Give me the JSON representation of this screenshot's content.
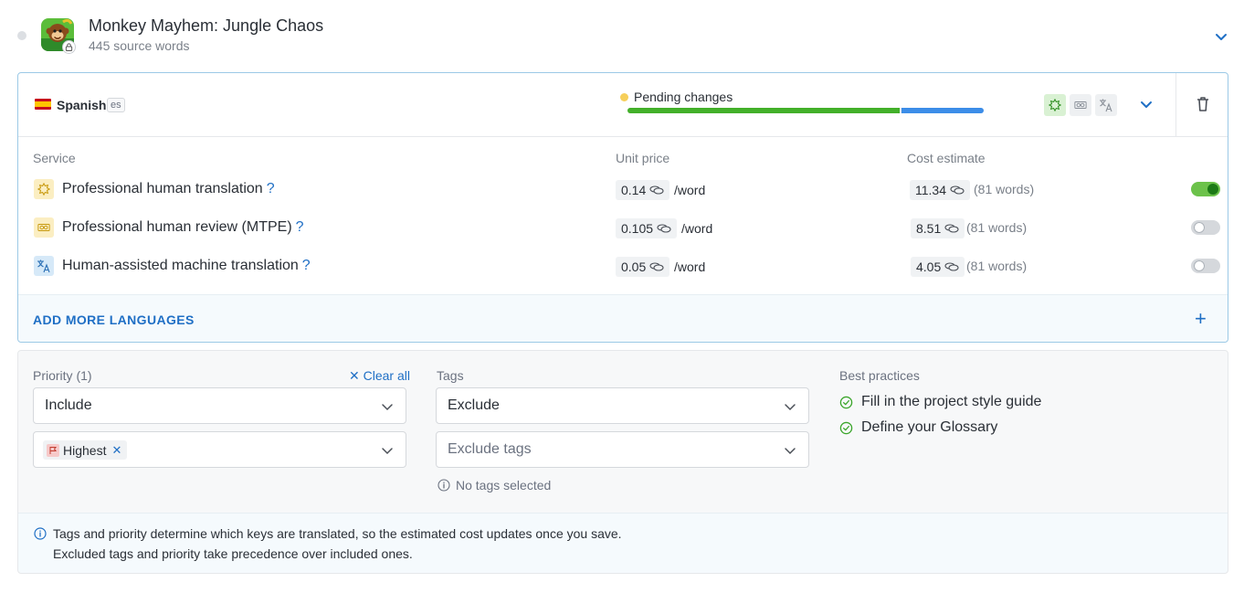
{
  "project": {
    "title": "Monkey Mayhem: Jungle Chaos",
    "subtitle": "445 source words"
  },
  "language": {
    "name": "Spanish",
    "code": "es",
    "status": "Pending changes",
    "progress": {
      "completed_fraction": 0.764,
      "in_progress_fraction": 0.23
    }
  },
  "services_table": {
    "headers": {
      "service": "Service",
      "unit_price": "Unit price",
      "cost_estimate": "Cost estimate"
    },
    "rows": [
      {
        "name": "Professional human translation",
        "help": "?",
        "unit_price": "0.14",
        "per": "/word",
        "cost": "11.34",
        "words": "(81 words)",
        "enabled": true,
        "icon": "star-badge-icon"
      },
      {
        "name": "Professional human review (MTPE)",
        "help": "?",
        "unit_price": "0.105",
        "per": "/word",
        "cost": "8.51",
        "words": "(81 words)",
        "enabled": false,
        "icon": "review-glasses-icon"
      },
      {
        "name": "Human-assisted machine translation",
        "help": "?",
        "unit_price": "0.05",
        "per": "/word",
        "cost": "4.05",
        "words": "(81 words)",
        "enabled": false,
        "icon": "translate-icon"
      }
    ]
  },
  "add_more": {
    "label": "ADD MORE LANGUAGES",
    "plus": "+"
  },
  "filters": {
    "priority": {
      "label": "Priority (1)",
      "clear_all": "Clear all",
      "mode": "Include",
      "selected_tag": "Highest"
    },
    "tags": {
      "label": "Tags",
      "mode": "Exclude",
      "placeholder": "Exclude tags",
      "note": "No tags selected"
    },
    "best_practices": {
      "label": "Best practices",
      "items": [
        "Fill in the project style guide",
        "Define your Glossary"
      ]
    },
    "info": {
      "line1": "Tags and priority determine which keys are translated, so the estimated cost updates once you save.",
      "line2": "Excluded tags and priority take precedence over included ones."
    }
  },
  "colors": {
    "accent": "#1f6fc5",
    "progress_green": "#43b02a",
    "progress_blue": "#3c8de8",
    "pending_yellow": "#f6cf5a",
    "toggle_on": "#6cc24a"
  }
}
